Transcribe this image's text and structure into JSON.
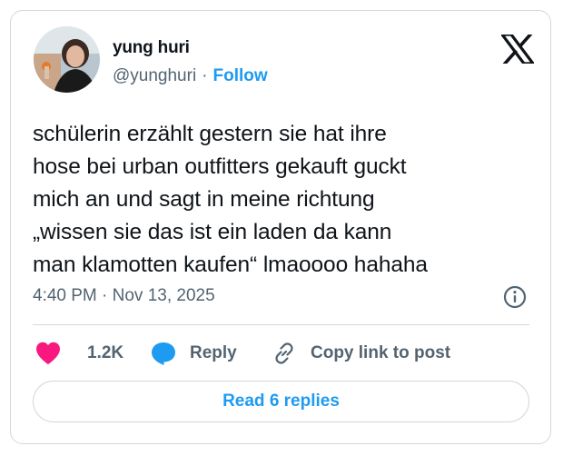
{
  "author": {
    "display_name": "yung huri",
    "handle": "@yunghuri",
    "separator": "·",
    "follow_label": "Follow",
    "avatar_icon": "profile-photo"
  },
  "platform_icon": "x-logo-icon",
  "tweet": {
    "lines": [
      "schülerin erzählt gestern sie hat ihre",
      "hose bei urban outfitters gekauft guckt",
      "mich an und sagt in meine richtung",
      "„wissen sie das ist ein laden da kann",
      "man klamotten kaufen“ lmaoooo hahaha"
    ],
    "timestamp": "4:40 PM · Nov 13, 2025"
  },
  "actions": {
    "like_count": "1.2K",
    "reply_label": "Reply",
    "copy_link_label": "Copy link to post"
  },
  "read_replies_label": "Read 6 replies",
  "colors": {
    "like": "#f91880",
    "reply": "#1d9bf0",
    "link": "#1d9bf0",
    "muted": "#536471",
    "border": "#cfd9de"
  }
}
